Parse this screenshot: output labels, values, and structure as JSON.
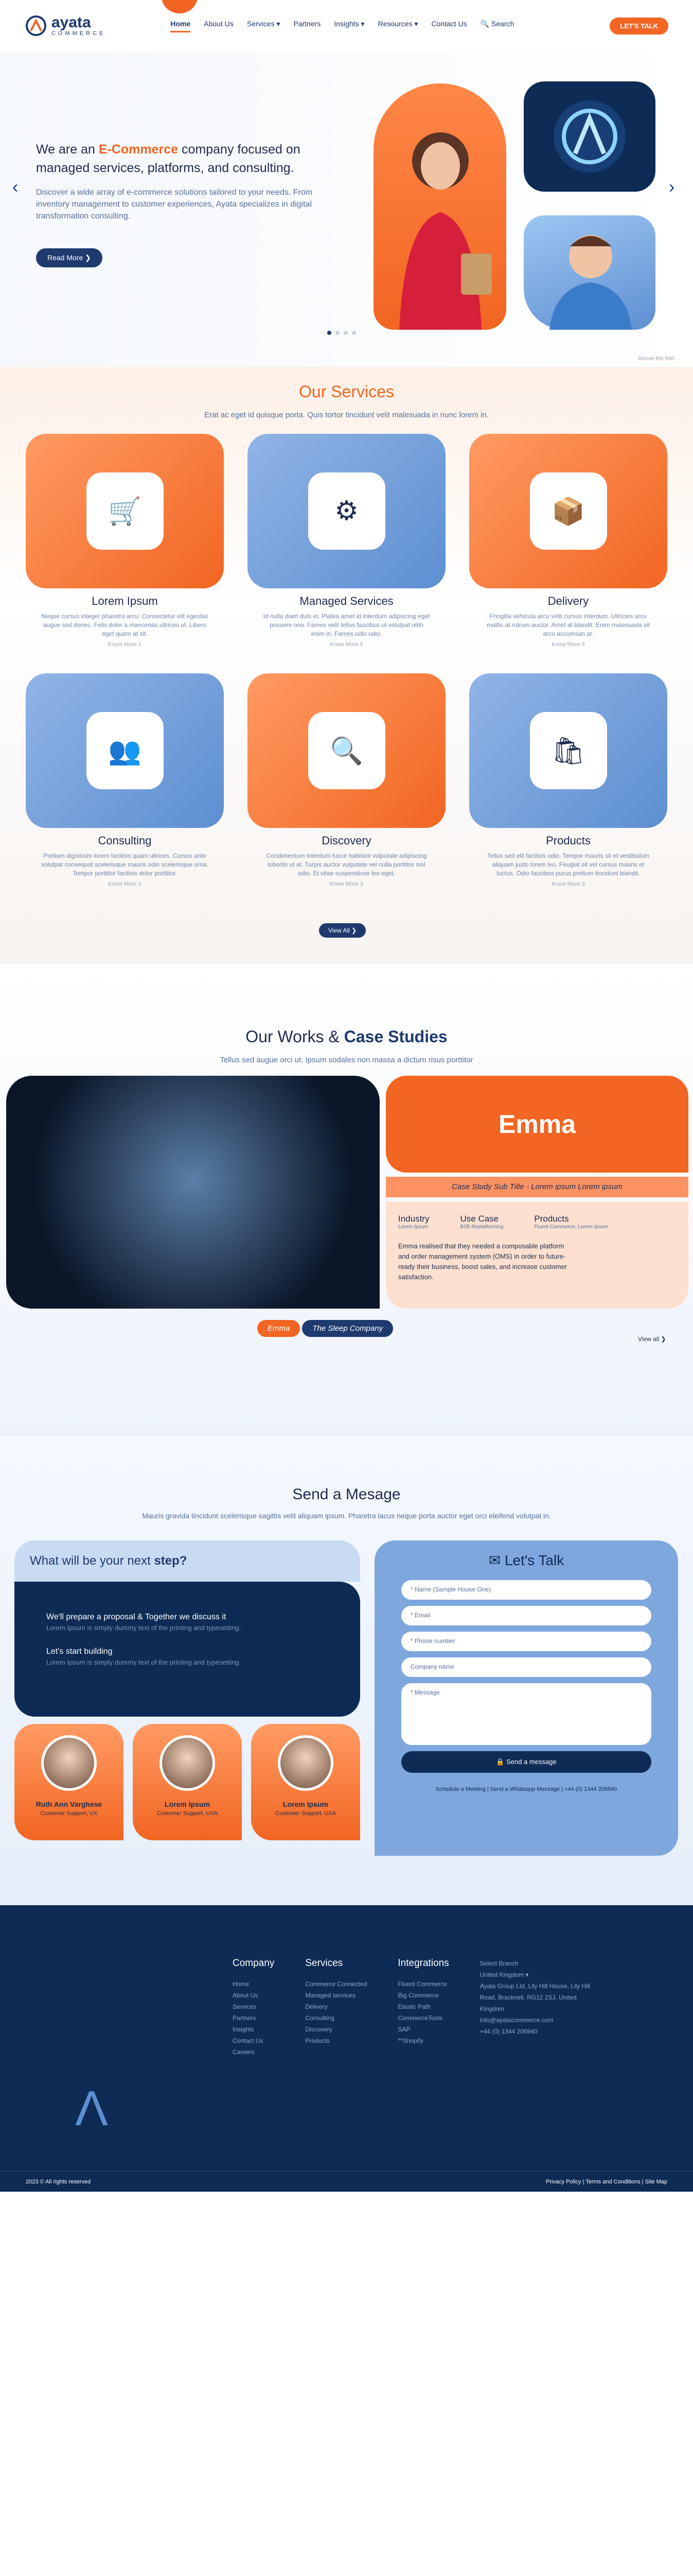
{
  "header": {
    "brand": "ayata",
    "brand_sub": "COMMERCE",
    "nav": [
      "Home",
      "About Us",
      "Services ▾",
      "Partners",
      "Insights ▾",
      "Resources ▾",
      "Contact Us",
      "🔍 Search"
    ],
    "cta": "LET'S TALK"
  },
  "hero": {
    "title_a": "We are an ",
    "title_b": "E-Commerce",
    "title_c": " company focused on managed services, platforms, and consulting.",
    "text": "Discover a wide array of e-commerce solutions tailored to your needs. From inventory management to customer experiences, Ayata specializes in digital transformation consulting.",
    "button": "Read More ❯",
    "caption": "Above the fold"
  },
  "services": {
    "title": "Our Services",
    "sub": "Erat ac eget id quisque porta. Quis tortor tincidunt velit malesuada in nunc lorem in.",
    "items": [
      {
        "name": "Lorem Ipsum",
        "text": "Neque cursus integer pharetra arcu. Consectetur elit egestas augue sed donec. Felis dolor a maecenas ultrices ut. Libero eget quam at sit.",
        "more": "Know More 1"
      },
      {
        "name": "Managed Services",
        "text": "Id nulla diam duis et. Platea amet id interdum adipiscing eget posuere non. Fames velit tellus faucibus ut volutpat nibh enim in. Fames odio odio.",
        "more": "Know More 5"
      },
      {
        "name": "Delivery",
        "text": "Fringilla vehicula arcu velit cursus interdum. Ultricies arcu mattis at rutrum auctor. Amet at blandit. Enim malesuada sit arcu accumsan at.",
        "more": "Know More 5"
      },
      {
        "name": "Consulting",
        "text": "Pretium dignissim lorem facilisis quam ultrices. Cursus ante volutpat consequat scelerisque mauris odio scelerisque urna. Tempor porttitor facilisis dolor porttitor.",
        "more": "Know More 3"
      },
      {
        "name": "Discovery",
        "text": "Condimentum interdum fusce habitant vulputate adipiscing lobortis ut at. Turpis auctor vulputate vel nulla porttitor nisl odio. Et vitae suspendisse leo eget.",
        "more": "Know More 3"
      },
      {
        "name": "Products",
        "text": "Tellus sed elit facilisis odio. Tempor mauris sit et vestibulum aliquam justo lorem leo. Feugiat sit vel cursus mauris et luctus. Odio faucibus purus pretium tincidunt blandit.",
        "more": "Know More 3"
      }
    ],
    "view_all": "View All ❯"
  },
  "works": {
    "title_a": "Our Works & ",
    "title_b": "Case Studies",
    "sub": "Tellus sed augue orci ut. Ipsum sodales non massa a dictum risus porttitor",
    "client": "Emma",
    "subtitle": "Case Study Sub Title - Lorem ipsum Lorem ipsum",
    "industry": "Industry",
    "industry_v": "Lorem Ipsum",
    "usecase": "Use Case",
    "usecase_v": "B2B Replatforming",
    "products": "Products",
    "products_v": "Fluent Commerce, Lorem Ipsum",
    "desc": "Emma realised that they needed a composable platform and order management system (OMS) in order to future-ready their business, boost sales, and increase customer satisfaction.",
    "tag1": "Emma",
    "tag2": "The Sleep Company",
    "view_all": "View all ❯"
  },
  "message": {
    "title": "Send a Mesage",
    "sub": "Mauris gravida tincidunt scelerisque sagittis velit aliquam ipsum. Pharetra lacus neque porta auctor eget orci eleifend volutpat in.",
    "q_a": "What will be your next ",
    "q_b": "step?",
    "s1": "We'll prepare a proposal & Together we discuss it",
    "s1d": "Lorem Ipsum is simply dummy text of the printing and typesetting.",
    "s2": "Let's start building",
    "s2d": "Lorem Ipsum is simply dummy text of the printing and typesetting.",
    "people": [
      {
        "n": "Ruth Ann Varghese",
        "r": "Customer Support, UX"
      },
      {
        "n": "Lorem Ipsum",
        "r": "Customer Support, UXA"
      },
      {
        "n": "Lorem Ipsum",
        "r": "Customer Support, UXA"
      }
    ],
    "form_title": "✉ Let's Talk",
    "fields": [
      "* Name (Sample House One)",
      "* Email",
      "* Phone number",
      "Company name",
      "* Message"
    ],
    "send": "🔒 Send a message",
    "links": "Schedule a Meeting | Send a Whatsapp Message | +44 (0) 1344 206940"
  },
  "footer": {
    "company": "Company",
    "company_items": [
      "Home",
      "About Us",
      "Services",
      "Partners",
      "Insights",
      "Contact Us",
      "Careers"
    ],
    "services": "Services",
    "services_items": [
      "Commerce Connected",
      "Managed services",
      "Delivery",
      "Consulting",
      "Discovery",
      "Products"
    ],
    "integrations": "Integrations",
    "integ_items": [
      "Fluent Commerce",
      "Big Commerce",
      "Elastic Path",
      "CommerceTools",
      "SAP",
      "**Shopify"
    ],
    "branch": "Select Branch",
    "branch_v": "United Kingdom ▾",
    "addr": "Ayata Group Ltd, Lily Hill House, Lily Hill Road, Bracknell, RG12 2SJ, United Kingdom",
    "email": "info@ayatacommerce.com",
    "phone": "+44 (0) 1344 206940",
    "copy": "2023 © All rights reserved",
    "legal": "Privacy Policy | Terms and Conditions | Site Map"
  }
}
